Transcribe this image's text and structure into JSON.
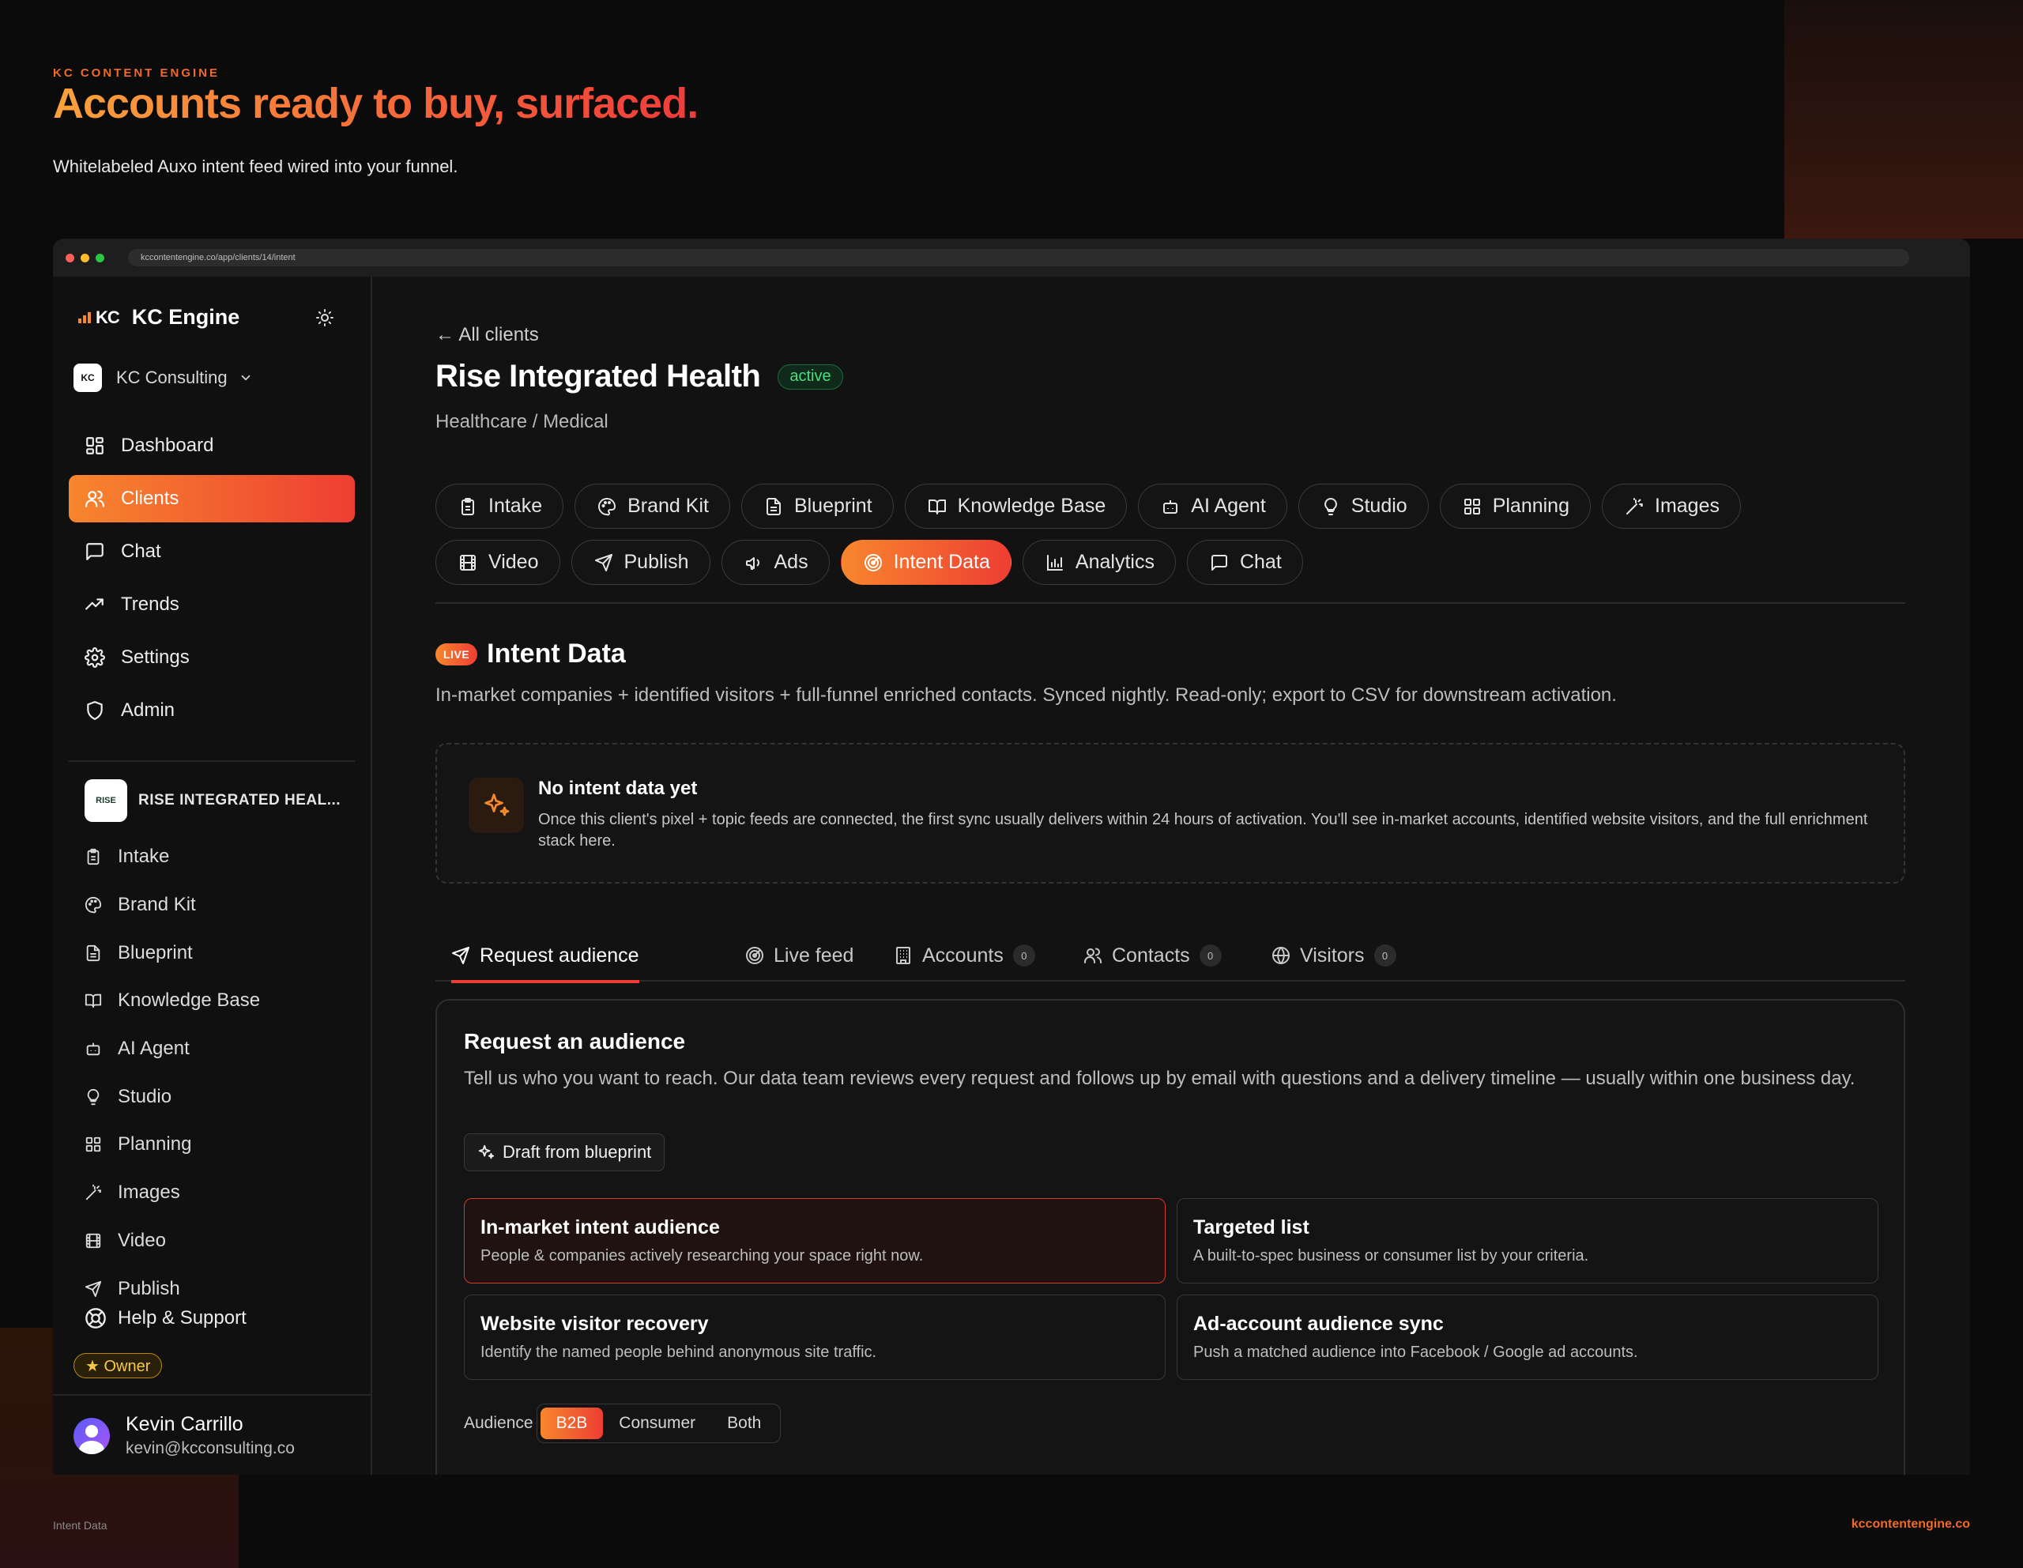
{
  "hero": {
    "eyebrow": "KC CONTENT ENGINE",
    "headline": "Accounts ready to buy, surfaced.",
    "subheadline": "Whitelabeled Auxo intent feed wired into your funnel."
  },
  "footer": {
    "left": "Intent Data",
    "right": "kccontentengine.co"
  },
  "browser": {
    "url": "kccontentengine.co/app/clients/14/intent"
  },
  "sidebar": {
    "brand_logo": "KC",
    "brand_name": "KC Engine",
    "org_avatar": "KC",
    "org_name": "KC Consulting",
    "nav": [
      {
        "label": "Dashboard",
        "icon": "grid-icon"
      },
      {
        "label": "Clients",
        "icon": "users-icon",
        "active": true
      },
      {
        "label": "Chat",
        "icon": "message-icon"
      },
      {
        "label": "Trends",
        "icon": "trending-icon"
      },
      {
        "label": "Settings",
        "icon": "gear-icon"
      },
      {
        "label": "Admin",
        "icon": "shield-icon"
      }
    ],
    "client_logo": "RISE",
    "client_name": "RISE INTEGRATED HEAL...",
    "client_nav": [
      "Intake",
      "Brand Kit",
      "Blueprint",
      "Knowledge Base",
      "AI Agent",
      "Studio",
      "Planning",
      "Images",
      "Video",
      "Publish"
    ],
    "help": "Help & Support",
    "role_badge": "★ Owner",
    "user": {
      "name": "Kevin Carrillo",
      "email": "kevin@kcconsulting.co"
    }
  },
  "main": {
    "back_link": "← All clients",
    "client_title": "Rise Integrated Health",
    "status": "active",
    "industry": "Healthcare / Medical",
    "tabs_row1": [
      "Intake",
      "Brand Kit",
      "Blueprint",
      "Knowledge Base",
      "AI Agent",
      "Studio",
      "Planning",
      "Images"
    ],
    "tabs_row2": [
      "Video",
      "Publish",
      "Ads",
      "Intent Data",
      "Analytics",
      "Chat"
    ],
    "active_tab": "Intent Data",
    "live_badge": "LIVE",
    "section_title": "Intent Data",
    "section_desc": "In-market companies + identified visitors + full-funnel enriched contacts. Synced nightly. Read-only; export to CSV for downstream activation.",
    "empty": {
      "title": "No intent data yet",
      "body": "Once this client's pixel + topic feeds are connected, the first sync usually delivers within 24 hours of activation. You'll see in-market accounts, identified website visitors, and the full enrichment stack here."
    },
    "subtabs": [
      {
        "label": "Request audience",
        "count": null
      },
      {
        "label": "Live feed",
        "count": null
      },
      {
        "label": "Accounts",
        "count": "0"
      },
      {
        "label": "Contacts",
        "count": "0"
      },
      {
        "label": "Visitors",
        "count": "0"
      }
    ],
    "request": {
      "title": "Request an audience",
      "desc": "Tell us who you want to reach. Our data team reviews every request and follows up by email with questions and a delivery timeline — usually within one business day.",
      "draft_button": "Draft from blueprint",
      "options": [
        {
          "title": "In-market intent audience",
          "desc": "People & companies actively researching your space right now.",
          "selected": true
        },
        {
          "title": "Targeted list",
          "desc": "A built-to-spec business or consumer list by your criteria.",
          "selected": false
        },
        {
          "title": "Website visitor recovery",
          "desc": "Identify the named people behind anonymous site traffic.",
          "selected": false
        },
        {
          "title": "Ad-account audience sync",
          "desc": "Push a matched audience into Facebook / Google ad accounts.",
          "selected": false
        }
      ],
      "audience_label": "Audience",
      "audience_options": [
        "B2B",
        "Consumer",
        "Both"
      ],
      "audience_selected": "B2B"
    }
  }
}
